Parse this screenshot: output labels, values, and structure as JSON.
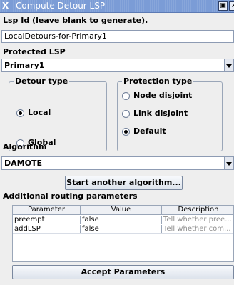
{
  "window": {
    "title": "Compute Detour LSP",
    "app_icon": "X",
    "max_glyph": "▣",
    "close_glyph": "x"
  },
  "lsp_id": {
    "label": "Lsp Id (leave blank to generate).",
    "value": "LocalDetours-for-Primary1"
  },
  "protected_lsp": {
    "label": "Protected LSP",
    "selected": "Primary1"
  },
  "detour_type": {
    "legend": "Detour type",
    "options": [
      {
        "label": "Local",
        "selected": true
      },
      {
        "label": "Global",
        "selected": false
      }
    ]
  },
  "protection_type": {
    "legend": "Protection type",
    "options": [
      {
        "label": "Node disjoint",
        "selected": false
      },
      {
        "label": "Link disjoint",
        "selected": false
      },
      {
        "label": "Default",
        "selected": true
      }
    ]
  },
  "algorithm": {
    "label": "Algorithm",
    "selected": "DAMOTE",
    "start_another_label": "Start another algorithm..."
  },
  "routing_params": {
    "label": "Additional routing parameters",
    "columns": [
      "Parameter",
      "Value",
      "Description"
    ],
    "rows": [
      [
        "preempt",
        "false",
        "Tell whether pree..."
      ],
      [
        "addLSP",
        "false",
        "Tell whether com..."
      ]
    ]
  },
  "accept_label": "Accept Parameters"
}
